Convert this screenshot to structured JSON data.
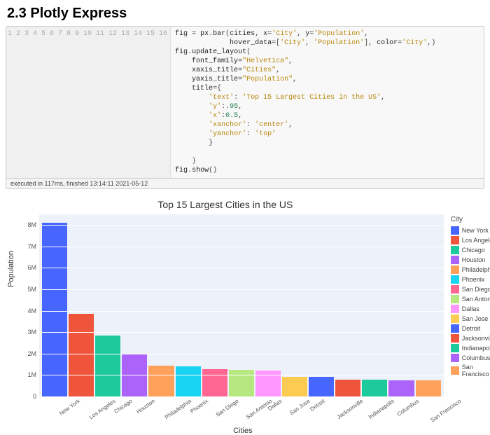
{
  "section_title": "2.3  Plotly Express",
  "code": {
    "line_numbers": [
      "1",
      "2",
      "3",
      "4",
      "5",
      "6",
      "7",
      "8",
      "9",
      "10",
      "11",
      "12",
      "13",
      "14",
      "15",
      "16"
    ],
    "lines": [
      [
        [
          "",
          "fig "
        ],
        [
          "punc",
          "="
        ],
        [
          "",
          " px"
        ],
        [
          "punc",
          "."
        ],
        [
          "",
          "bar"
        ],
        [
          "punc",
          "("
        ],
        [
          "",
          "cities"
        ],
        [
          "punc",
          ", "
        ],
        [
          "",
          "x"
        ],
        [
          "punc",
          "="
        ],
        [
          "str",
          "'City'"
        ],
        [
          "punc",
          ", "
        ],
        [
          "",
          "y"
        ],
        [
          "punc",
          "="
        ],
        [
          "str",
          "'Population'"
        ],
        [
          "punc",
          ","
        ]
      ],
      [
        [
          "",
          "             hover_data"
        ],
        [
          "punc",
          "="
        ],
        [
          "punc",
          "["
        ],
        [
          "str",
          "'City'"
        ],
        [
          "punc",
          ", "
        ],
        [
          "str",
          "'Population'"
        ],
        [
          "punc",
          "], "
        ],
        [
          "",
          "color"
        ],
        [
          "punc",
          "="
        ],
        [
          "str",
          "'City'"
        ],
        [
          "punc",
          ",)"
        ]
      ],
      [
        [
          "",
          "fig"
        ],
        [
          "punc",
          "."
        ],
        [
          "",
          "update_layout"
        ],
        [
          "punc",
          "("
        ]
      ],
      [
        [
          "",
          "    font_family"
        ],
        [
          "punc",
          "="
        ],
        [
          "str",
          "\"Helvetica\""
        ],
        [
          "punc",
          ","
        ]
      ],
      [
        [
          "",
          "    xaxis_title"
        ],
        [
          "punc",
          "="
        ],
        [
          "str",
          "\"Cities\""
        ],
        [
          "punc",
          ","
        ]
      ],
      [
        [
          "",
          "    yaxis_title"
        ],
        [
          "punc",
          "="
        ],
        [
          "str",
          "\"Population\""
        ],
        [
          "punc",
          ","
        ]
      ],
      [
        [
          "",
          "    title"
        ],
        [
          "punc",
          "="
        ],
        [
          "punc",
          "{"
        ]
      ],
      [
        [
          "",
          "        "
        ],
        [
          "str",
          "'text'"
        ],
        [
          "punc",
          ": "
        ],
        [
          "str",
          "'Top 15 Largest Cities in the US'"
        ],
        [
          "punc",
          ","
        ]
      ],
      [
        [
          "",
          "        "
        ],
        [
          "str",
          "'y'"
        ],
        [
          "punc",
          ":"
        ],
        [
          "num",
          ".95"
        ],
        [
          "punc",
          ","
        ]
      ],
      [
        [
          "",
          "        "
        ],
        [
          "str",
          "'x'"
        ],
        [
          "punc",
          ":"
        ],
        [
          "num",
          "0.5"
        ],
        [
          "punc",
          ","
        ]
      ],
      [
        [
          "",
          "        "
        ],
        [
          "str",
          "'xanchor'"
        ],
        [
          "punc",
          ": "
        ],
        [
          "str",
          "'center'"
        ],
        [
          "punc",
          ","
        ]
      ],
      [
        [
          "",
          "        "
        ],
        [
          "str",
          "'yanchor'"
        ],
        [
          "punc",
          ": "
        ],
        [
          "str",
          "'top'"
        ]
      ],
      [
        [
          "",
          "        "
        ],
        [
          "punc",
          "}"
        ]
      ],
      [
        [
          "",
          ""
        ]
      ],
      [
        [
          "",
          "    "
        ],
        [
          "punc",
          ")"
        ]
      ],
      [
        [
          "",
          "fig"
        ],
        [
          "punc",
          "."
        ],
        [
          "",
          "show"
        ],
        [
          "punc",
          "()"
        ]
      ]
    ]
  },
  "exec_text": "executed in 117ms, finished 13:14:11 2021-05-12",
  "chart_data": {
    "type": "bar",
    "title": "Top 15 Largest Cities in the US",
    "xlabel": "Cities",
    "ylabel": "Population",
    "legend_title": "City",
    "ylim": [
      0,
      8500000
    ],
    "yticks": [
      0,
      1000000,
      2000000,
      3000000,
      4000000,
      5000000,
      6000000,
      7000000,
      8000000
    ],
    "ytick_labels": [
      "0",
      "1M",
      "2M",
      "3M",
      "4M",
      "5M",
      "6M",
      "7M",
      "8M"
    ],
    "categories": [
      "New York",
      "Los Angeles",
      "Chicago",
      "Houston",
      "Philadelphia",
      "Phoenix",
      "San Diego",
      "San Antonio",
      "Dallas",
      "San Jose",
      "Detroit",
      "Jacksonville",
      "Indianapolis",
      "Columbus",
      "San Francisco"
    ],
    "values": [
      8100000,
      3850000,
      2850000,
      2000000,
      1450000,
      1400000,
      1280000,
      1250000,
      1200000,
      920000,
      900000,
      780000,
      780000,
      760000,
      740000
    ],
    "colors": [
      "#4766ff",
      "#ef553b",
      "#1cca9b",
      "#ab63fa",
      "#ffa15a",
      "#19d3f3",
      "#ff6692",
      "#b6e880",
      "#ff97ff",
      "#fecb52",
      "#4766ff",
      "#ef553b",
      "#1cca9b",
      "#ab63fa",
      "#ffa15a"
    ]
  }
}
